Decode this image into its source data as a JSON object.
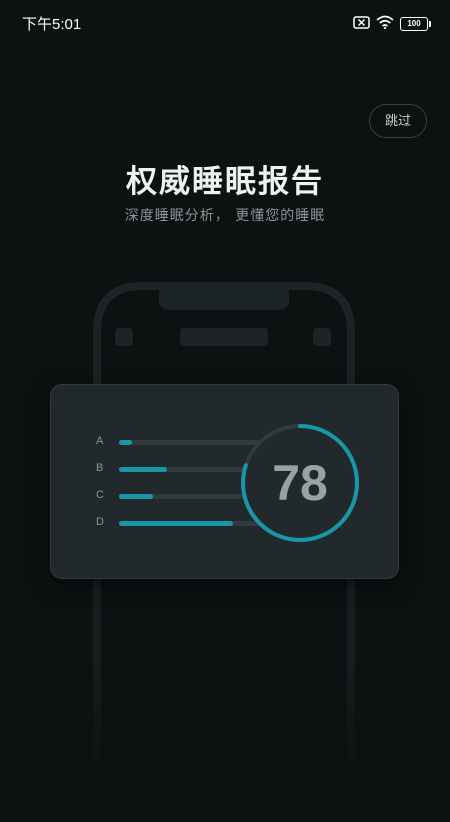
{
  "status_bar": {
    "time": "下午5:01",
    "battery": "100",
    "icons": [
      "sim-blocked-icon",
      "wifi-icon",
      "battery-icon"
    ]
  },
  "skip_button": {
    "label": "跳过"
  },
  "intro": {
    "title": "权威睡眠报告",
    "subtitle": "深度睡眠分析， 更懂您的睡眠"
  },
  "report_card": {
    "score": "78",
    "score_progress": 0.8,
    "bars": [
      {
        "label": "A",
        "fill": 0.08
      },
      {
        "label": "B",
        "fill": 0.3
      },
      {
        "label": "C",
        "fill": 0.21
      },
      {
        "label": "D",
        "fill": 0.71
      }
    ]
  },
  "colors": {
    "background": "#0d1112",
    "card": "#22292c",
    "accent": "#1797a8"
  }
}
